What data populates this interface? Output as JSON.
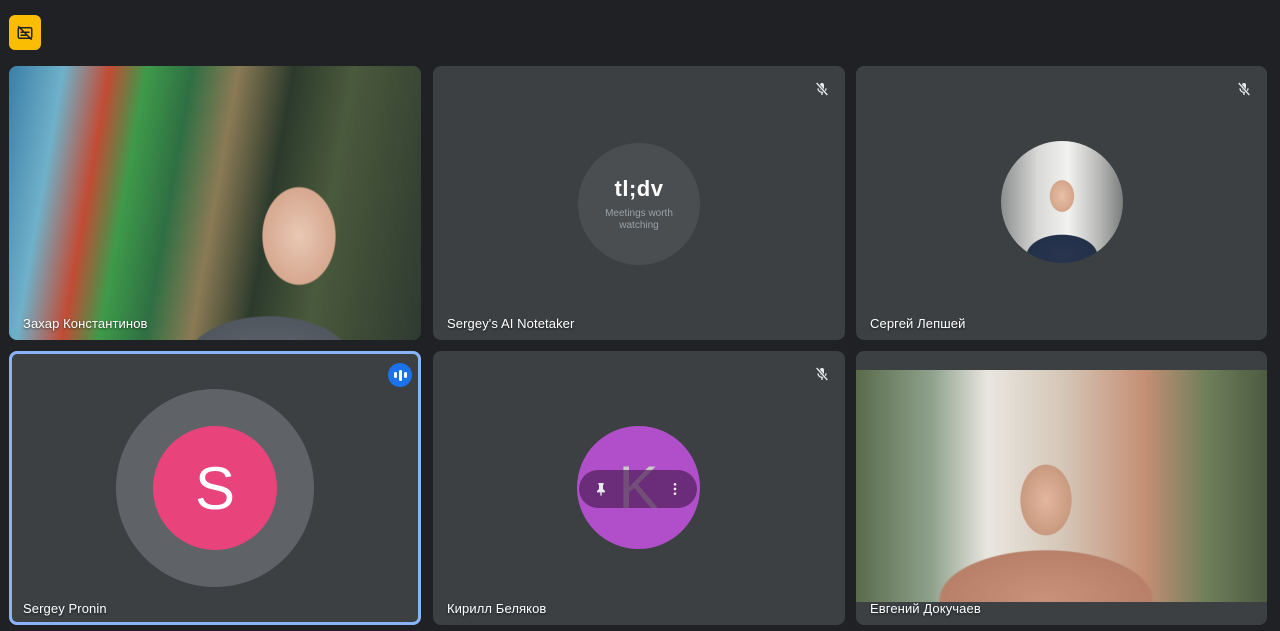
{
  "colors": {
    "background": "#202124",
    "tile": "#3c4043",
    "active_outline": "#8ab4f8",
    "speaking_badge": "#1a73e8",
    "recording_badge": "#fbbc04",
    "avatar_s": "#e8437a",
    "avatar_k": "#b04fc9"
  },
  "topbar": {
    "badge_icon": "captions-off-icon"
  },
  "tiles": [
    {
      "name": "Захар Константинов",
      "type": "video",
      "mic": "on"
    },
    {
      "name": "Sergey's AI Notetaker",
      "type": "logo",
      "mic": "muted",
      "logo": {
        "text": "tl;dv",
        "subtitle": "Meetings worth watching"
      }
    },
    {
      "name": "Сергей Лепшей",
      "type": "avatar-photo",
      "mic": "muted"
    },
    {
      "name": "Sergey Pronin",
      "type": "letter-avatar",
      "letter": "S",
      "mic": "speaking",
      "active": true
    },
    {
      "name": "Кирилл Беляков",
      "type": "letter-avatar",
      "letter": "K",
      "mic": "muted",
      "hover_controls": [
        "pin-icon",
        "more-vert-icon"
      ]
    },
    {
      "name": "Евгений Докучаев",
      "type": "video",
      "mic": "on"
    }
  ]
}
